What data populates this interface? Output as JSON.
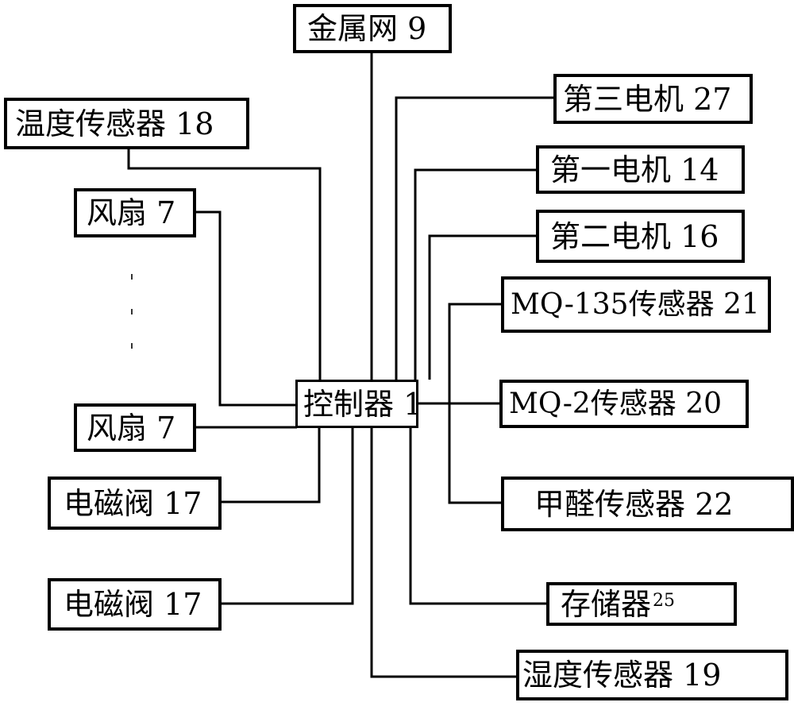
{
  "diagram": {
    "type": "block-diagram",
    "center": {
      "id": "controller",
      "label": "控制器 1"
    },
    "nodes": [
      {
        "id": "metal-mesh",
        "label": "金属网 9"
      },
      {
        "id": "temp-sensor",
        "label": "温度传感器 18"
      },
      {
        "id": "fan-top",
        "label": "风扇 7"
      },
      {
        "id": "fan-bottom",
        "label": "风扇 7"
      },
      {
        "id": "solenoid-valve-1",
        "label": "电磁阀 17"
      },
      {
        "id": "solenoid-valve-2",
        "label": "电磁阀 17"
      },
      {
        "id": "third-motor",
        "label": "第三电机 27"
      },
      {
        "id": "first-motor",
        "label": "第一电机 14"
      },
      {
        "id": "second-motor",
        "label": "第二电机 16"
      },
      {
        "id": "mq135-sensor",
        "label": "MQ-135传感器 21"
      },
      {
        "id": "mq2-sensor",
        "label": "MQ-2传感器 20"
      },
      {
        "id": "formaldehyde-sensor",
        "label": "甲醛传感器 22"
      },
      {
        "id": "memory",
        "label": "存储器",
        "number": "25"
      },
      {
        "id": "humidity-sensor",
        "label": "湿度传感器 19"
      }
    ],
    "edges": [
      [
        "controller",
        "metal-mesh"
      ],
      [
        "controller",
        "temp-sensor"
      ],
      [
        "controller",
        "fan-top"
      ],
      [
        "controller",
        "fan-bottom"
      ],
      [
        "controller",
        "solenoid-valve-1"
      ],
      [
        "controller",
        "solenoid-valve-2"
      ],
      [
        "controller",
        "third-motor"
      ],
      [
        "controller",
        "first-motor"
      ],
      [
        "controller",
        "second-motor"
      ],
      [
        "controller",
        "mq135-sensor"
      ],
      [
        "controller",
        "mq2-sensor"
      ],
      [
        "controller",
        "formaldehyde-sensor"
      ],
      [
        "controller",
        "memory"
      ],
      [
        "controller",
        "humidity-sensor"
      ]
    ],
    "ellipsis": "⋮"
  }
}
